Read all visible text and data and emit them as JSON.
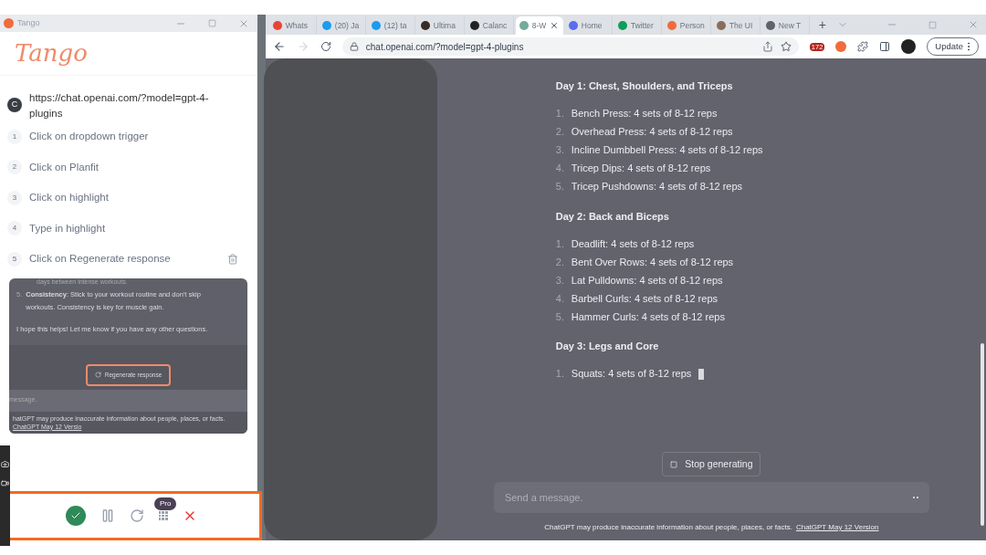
{
  "tango": {
    "window_title": "Tango",
    "logo": "Tango",
    "start": {
      "avatar": "C",
      "url": "https://chat.openai.com/?model=gpt-4-plugins"
    },
    "steps": [
      {
        "number": "1",
        "text": "Click on dropdown trigger",
        "deletable": false
      },
      {
        "number": "2",
        "text": "Click on Planfit",
        "deletable": false
      },
      {
        "number": "3",
        "text": "Click on highlight",
        "deletable": false
      },
      {
        "number": "4",
        "text": "Type in highlight",
        "deletable": false
      },
      {
        "number": "5",
        "text": "Click on Regenerate response",
        "deletable": true
      }
    ],
    "preview": {
      "partial_line": "days between intense workouts.",
      "item_number": "5.",
      "item_text": "**Consistency**: Stick to your workout routine and don't skip workouts. Consistency is key for muscle gain.",
      "closing": "I hope this helps! Let me know if you have any other questions.",
      "button": "Regenerate response",
      "input": "message.",
      "footer": "hatGPT may produce inaccurate information about people, places, or facts.",
      "footer_link": "ChatGPT May 12 Versio"
    },
    "toolbar": {
      "badge": "Pro"
    }
  },
  "browser": {
    "tabs": [
      {
        "label": "Whats",
        "selected": false,
        "color": "#ea4335"
      },
      {
        "label": "(20) Ja",
        "selected": false,
        "color": "#1d9bf0"
      },
      {
        "label": "(12) ta",
        "selected": false,
        "color": "#1d9bf0"
      },
      {
        "label": "Ultima",
        "selected": false,
        "color": "#3a2c25"
      },
      {
        "label": "Calanc",
        "selected": false,
        "color": "#222222"
      },
      {
        "label": "8-W",
        "selected": true,
        "color": "#74aa9c"
      },
      {
        "label": "Home",
        "selected": false,
        "color": "#5b6cf0"
      },
      {
        "label": "Twitter",
        "selected": false,
        "color": "#0f9d58"
      },
      {
        "label": "Person",
        "selected": false,
        "color": "#f26b3a"
      },
      {
        "label": "The UI",
        "selected": false,
        "color": "#8a6d5a"
      },
      {
        "label": "New T",
        "selected": false,
        "color": "#5f6368"
      }
    ],
    "new_tab": "+",
    "url": "chat.openai.com/?model=gpt-4-plugins",
    "extension_badge": "172",
    "update": "Update"
  },
  "chat": {
    "sections": [
      {
        "heading": "Day 1: Chest, Shoulders, and Triceps",
        "items": [
          {
            "number": "1.",
            "text": "Bench Press: 4 sets of 8-12 reps"
          },
          {
            "number": "2.",
            "text": "Overhead Press: 4 sets of 8-12 reps"
          },
          {
            "number": "3.",
            "text": "Incline Dumbbell Press: 4 sets of 8-12 reps"
          },
          {
            "number": "4.",
            "text": "Tricep Dips: 4 sets of 8-12 reps"
          },
          {
            "number": "5.",
            "text": "Tricep Pushdowns: 4 sets of 8-12 reps"
          }
        ]
      },
      {
        "heading": "Day 2: Back and Biceps",
        "items": [
          {
            "number": "1.",
            "text": "Deadlift: 4 sets of 8-12 reps"
          },
          {
            "number": "2.",
            "text": "Bent Over Rows: 4 sets of 8-12 reps"
          },
          {
            "number": "3.",
            "text": "Lat Pulldowns: 4 sets of 8-12 reps"
          },
          {
            "number": "4.",
            "text": "Barbell Curls: 4 sets of 8-12 reps"
          },
          {
            "number": "5.",
            "text": "Hammer Curls: 4 sets of 8-12 reps"
          }
        ]
      },
      {
        "heading": "Day 3: Legs and Core",
        "items": [
          {
            "number": "1.",
            "text": "Squats: 4 sets of 8-12 reps"
          }
        ]
      }
    ],
    "stop": "Stop generating",
    "placeholder": "Send a message.",
    "disclaimer": "ChatGPT may produce inaccurate information about people, places, or facts.",
    "disclaimer_link": "ChatGPT May 12 Version"
  }
}
